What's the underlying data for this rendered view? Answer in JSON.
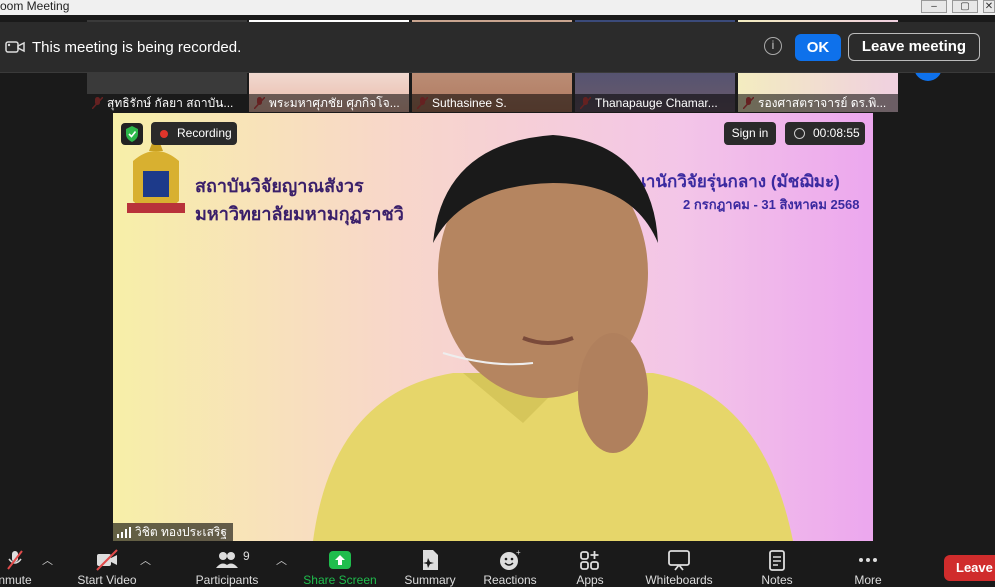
{
  "window": {
    "title": "oom Meeting"
  },
  "thumbnails": [
    {
      "name": "สุทธิรักษ์ กัลยา สถาบัน..."
    },
    {
      "name": "พระมหาศุภชัย ศุภกิจโจ..."
    },
    {
      "name": "Suthasinee S."
    },
    {
      "name": "Thanapauge Chamar..."
    },
    {
      "name": "รองศาสตราจารย์ ดร.พิ..."
    }
  ],
  "banner": {
    "message": "This meeting is being recorded.",
    "ok_label": "OK",
    "leave_label": "Leave meeting",
    "info": "i"
  },
  "main_video": {
    "recording_label": "Recording",
    "signin_label": "Sign in",
    "timer": "00:08:55",
    "speaker": "วิชิต ทองประเสริฐ",
    "slide": {
      "org_line1": "สถาบันวิจัยญาณสังวร",
      "org_line2": "มหาวิทยาลัยมหามกุฏราชวิ",
      "program": "ารพัฒนานักวิจัยรุ่นกลาง (มัชฌิมะ)",
      "dates": "2 กรกฎาคม - 31 สิงหาคม 2568"
    }
  },
  "toolbar": {
    "unmute": "nmute",
    "start_video": "Start Video",
    "participants": "Participants",
    "participants_count": "9",
    "share_screen": "Share Screen",
    "summary": "Summary",
    "reactions": "Reactions",
    "apps": "Apps",
    "whiteboards": "Whiteboards",
    "notes": "Notes",
    "more": "More",
    "leave": "Leave"
  },
  "colors": {
    "accent": "#0e71eb",
    "leave": "#d02c2c",
    "share": "#1fbd4d",
    "recording_dot": "#e0352b"
  }
}
